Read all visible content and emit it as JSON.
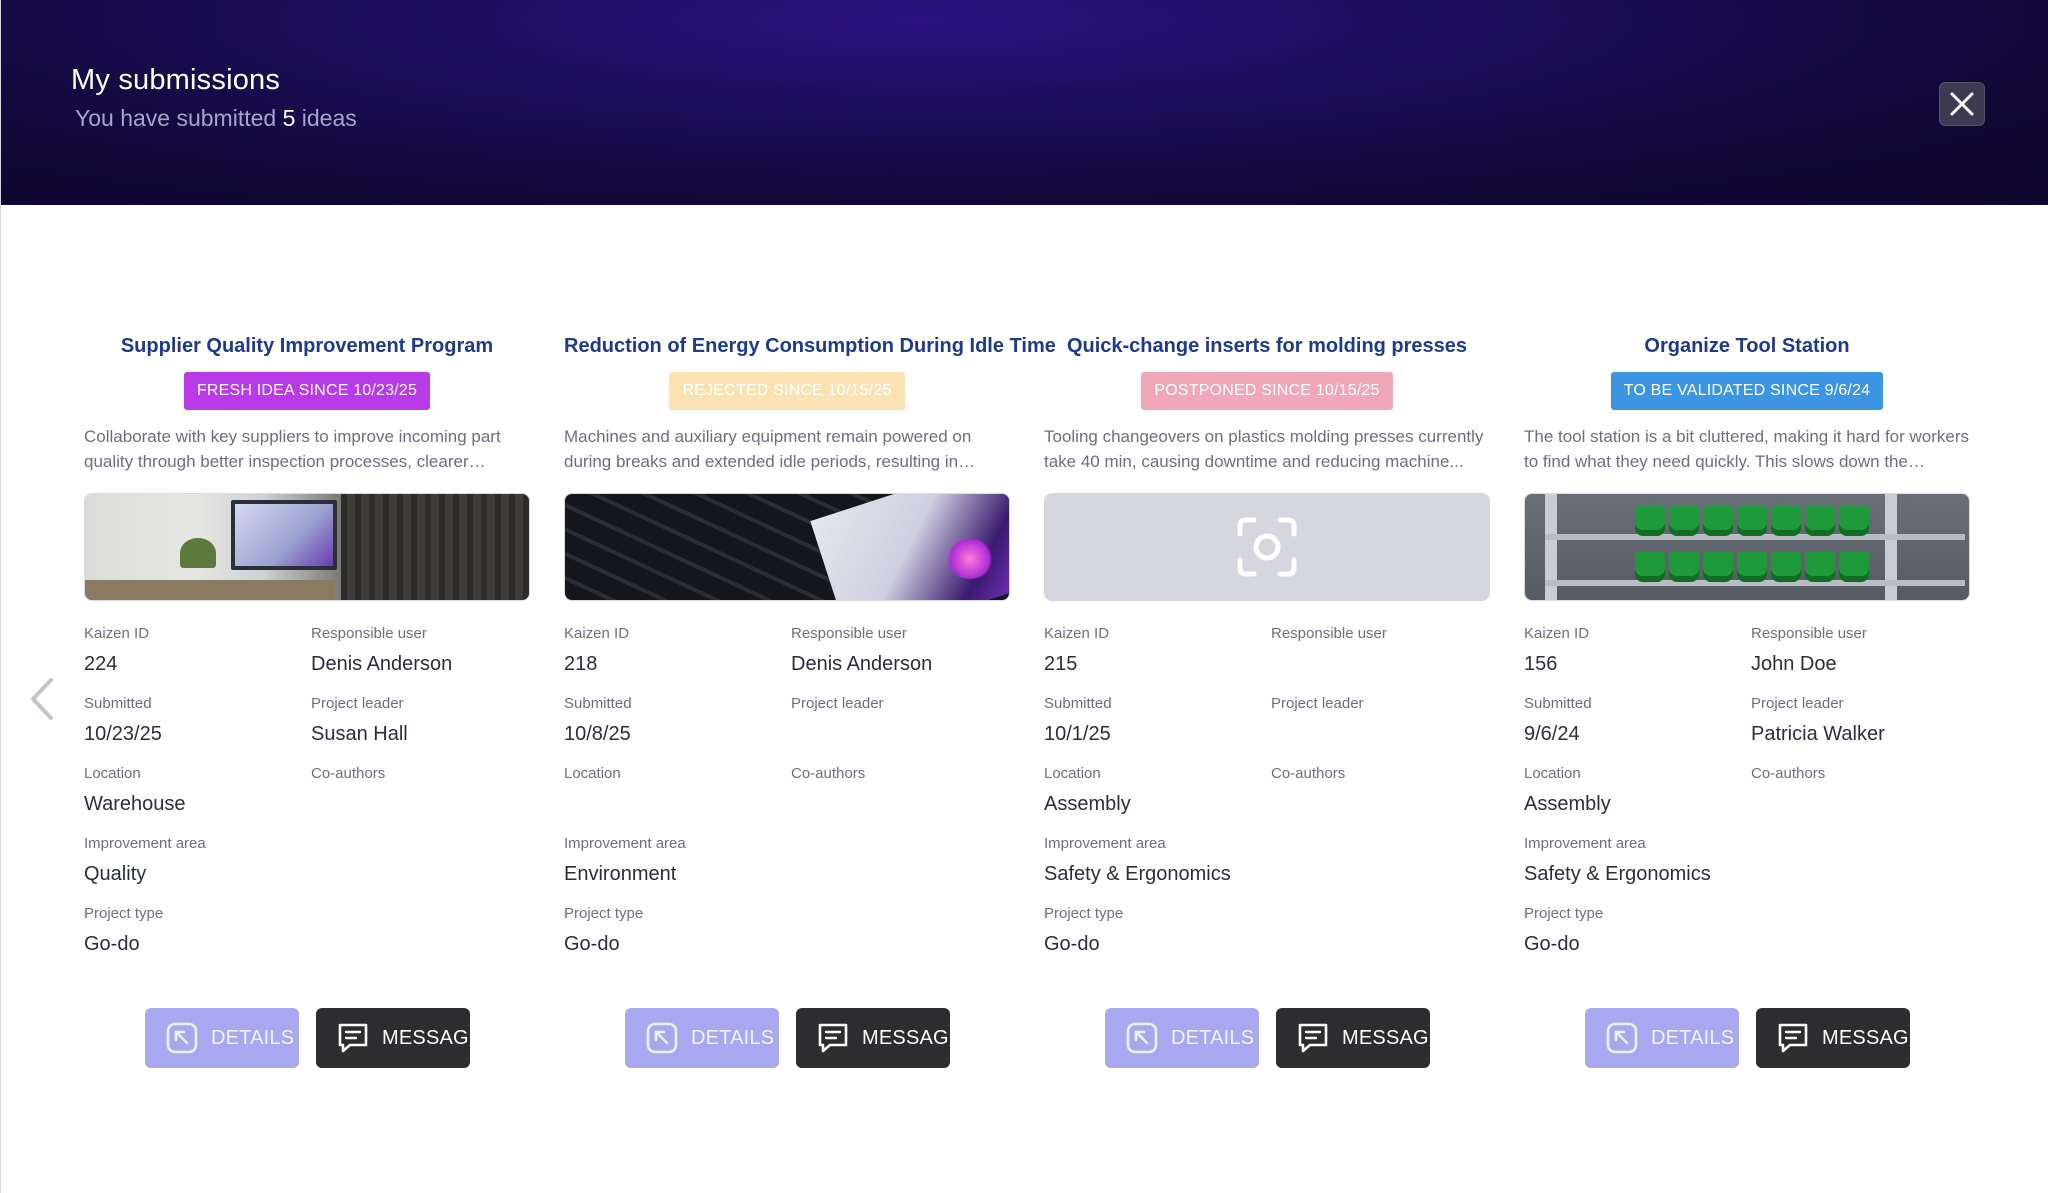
{
  "header": {
    "title": "My submissions",
    "subtitle_prefix": "You have submitted",
    "subtitle_count": "5",
    "subtitle_suffix": "ideas"
  },
  "labels": {
    "kaizen_id": "Kaizen ID",
    "responsible_user": "Responsible user",
    "submitted": "Submitted",
    "project_leader": "Project leader",
    "location": "Location",
    "co_authors": "Co-authors",
    "improvement_area": "Improvement area",
    "project_type": "Project type",
    "details": "DETAILS",
    "message": "MESSAGE"
  },
  "colors": {
    "fresh": "#b93be8",
    "rejected": "#fbe3b1",
    "postponed": "#f0a7b8",
    "to_validate": "#3b95e0",
    "details_btn": "#a7a8f0",
    "message_btn": "#2d2d30",
    "title": "#1e3a8a"
  },
  "cards": [
    {
      "title": "Supplier Quality Improvement Program",
      "status": "FRESH IDEA SINCE 10/23/25",
      "description": "Collaborate with key suppliers to improve incoming part quality through better inspection processes, clearer specifications,...",
      "image": "office-photo",
      "kaizen_id": "224",
      "responsible_user": "Denis Anderson",
      "submitted": "10/23/25",
      "project_leader": "Susan Hall",
      "location": "Warehouse",
      "co_authors": "",
      "improvement_area": "Quality",
      "project_type": "Go-do"
    },
    {
      "title": "Reduction of Energy Consumption During Idle Time",
      "status": "REJECTED SINCE 10/15/25",
      "description": "Machines and auxiliary equipment remain powered on during breaks and extended idle periods, resulting in unnecessary...",
      "image": "laptop-photo",
      "kaizen_id": "218",
      "responsible_user": "Denis Anderson",
      "submitted": "10/8/25",
      "project_leader": "",
      "location": "",
      "co_authors": "",
      "improvement_area": "Environment",
      "project_type": "Go-do"
    },
    {
      "title": "Quick-change inserts for molding presses",
      "status": "POSTPONED SINCE 10/15/25",
      "description": "Tooling changeovers on plastics molding presses currently take 40 min, causing downtime and reducing machine...",
      "image": "camera-placeholder-icon",
      "kaizen_id": "215",
      "responsible_user": "",
      "submitted": "10/1/25",
      "project_leader": "",
      "location": "Assembly",
      "co_authors": "",
      "improvement_area": "Safety & Ergonomics",
      "project_type": "Go-do"
    },
    {
      "title": "Organize Tool Station",
      "status": "TO BE VALIDATED SINCE 9/6/24",
      "description": "The tool station is a bit cluttered, making it hard for workers to find what they need quickly. This slows down the assembly...",
      "image": "tool-rack-photo",
      "kaizen_id": "156",
      "responsible_user": "John Doe",
      "submitted": "9/6/24",
      "project_leader": "Patricia Walker",
      "location": "Assembly",
      "co_authors": "",
      "improvement_area": "Safety & Ergonomics",
      "project_type": "Go-do"
    }
  ]
}
